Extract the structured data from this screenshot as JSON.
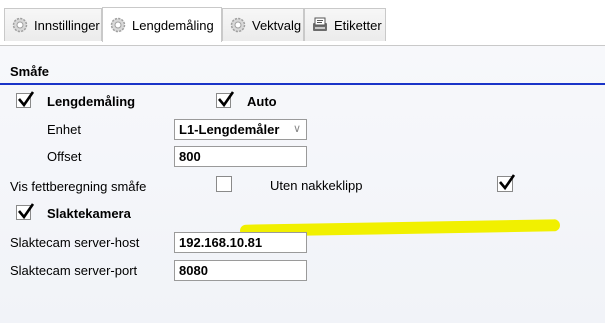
{
  "tabs": [
    {
      "label": "Innstillinger",
      "icon": "gear-icon"
    },
    {
      "label": "Lengdemåling",
      "icon": "gear-icon",
      "active": true
    },
    {
      "label": "Vektvalg",
      "icon": "gear-icon"
    },
    {
      "label": "Etiketter",
      "icon": "label-printer-icon"
    }
  ],
  "section": {
    "title": "Småfe"
  },
  "fields": {
    "lengdemaling": {
      "label": "Lengdemåling",
      "checked": true
    },
    "auto": {
      "label": "Auto",
      "checked": true
    },
    "enhet": {
      "label": "Enhet",
      "value": "L1-Lengdemåler"
    },
    "offset": {
      "label": "Offset",
      "value": "800"
    },
    "fettberegning": {
      "label": "Vis fettberegning småfe",
      "checked": false
    },
    "nakkeklipp": {
      "label": "Uten nakkeklipp",
      "checked": true
    },
    "slaktekamera": {
      "label": "Slaktekamera",
      "checked": true
    },
    "server_host": {
      "label": "Slaktecam server-host",
      "value": "192.168.10.81"
    },
    "server_port": {
      "label": "Slaktecam server-port",
      "value": "8080"
    }
  },
  "colors": {
    "section_rule": "#1a34c8",
    "highlight": "#f1f000"
  }
}
